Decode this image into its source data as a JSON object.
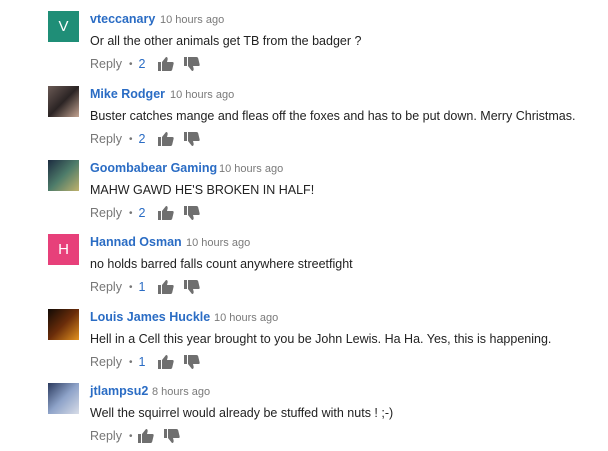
{
  "comments": [
    {
      "avatar": {
        "type": "letter",
        "letter": "V",
        "color": "#1f8e77"
      },
      "author": "vteccanary",
      "time": "10 hours ago",
      "text": "Or all the other animals get TB from the badger ?",
      "reply_label": "Reply",
      "separator": "•",
      "likes": "2"
    },
    {
      "avatar": {
        "type": "image",
        "colors": [
          "#6b5a55",
          "#2b2424",
          "#c4a492"
        ]
      },
      "author": "Mike Rodger",
      "time": "10 hours ago",
      "text": "Buster catches mange and fleas off the foxes and has to be put down. Merry Christmas.",
      "reply_label": "Reply",
      "separator": "•",
      "likes": "2"
    },
    {
      "avatar": {
        "type": "image",
        "colors": [
          "#1c2b40",
          "#4e7c6a",
          "#c0b26d"
        ]
      },
      "author": "Goombabear Gaming",
      "time": "10 hours ago",
      "text": "MAHW GAWD HE'S BROKEN IN HALF!",
      "reply_label": "Reply",
      "separator": "•",
      "likes": "2"
    },
    {
      "avatar": {
        "type": "letter",
        "letter": "H",
        "color": "#e7407a"
      },
      "author": "Hannad Osman",
      "time": "10 hours ago",
      "text": "no holds barred falls count anywhere streetfight",
      "reply_label": "Reply",
      "separator": "•",
      "likes": "1"
    },
    {
      "avatar": {
        "type": "image",
        "colors": [
          "#110a05",
          "#6b2d0a",
          "#e3921f"
        ]
      },
      "author": "Louis James Huckle",
      "time": "10 hours ago",
      "text": "Hell in a Cell this year brought to you be John Lewis. Ha Ha. Yes, this is happening.",
      "reply_label": "Reply",
      "separator": "•",
      "likes": "1"
    },
    {
      "avatar": {
        "type": "image",
        "colors": [
          "#2b3a5e",
          "#8ea3c9",
          "#d8dde8"
        ]
      },
      "author": "jtlampsu2",
      "time": "8 hours ago",
      "text": "Well the squirrel would already be stuffed with nuts ! ;-)",
      "reply_label": "Reply",
      "separator": "•",
      "likes": ""
    }
  ],
  "colors": {
    "author": "#2a6cc4",
    "meta": "#767676",
    "text": "#222222"
  }
}
